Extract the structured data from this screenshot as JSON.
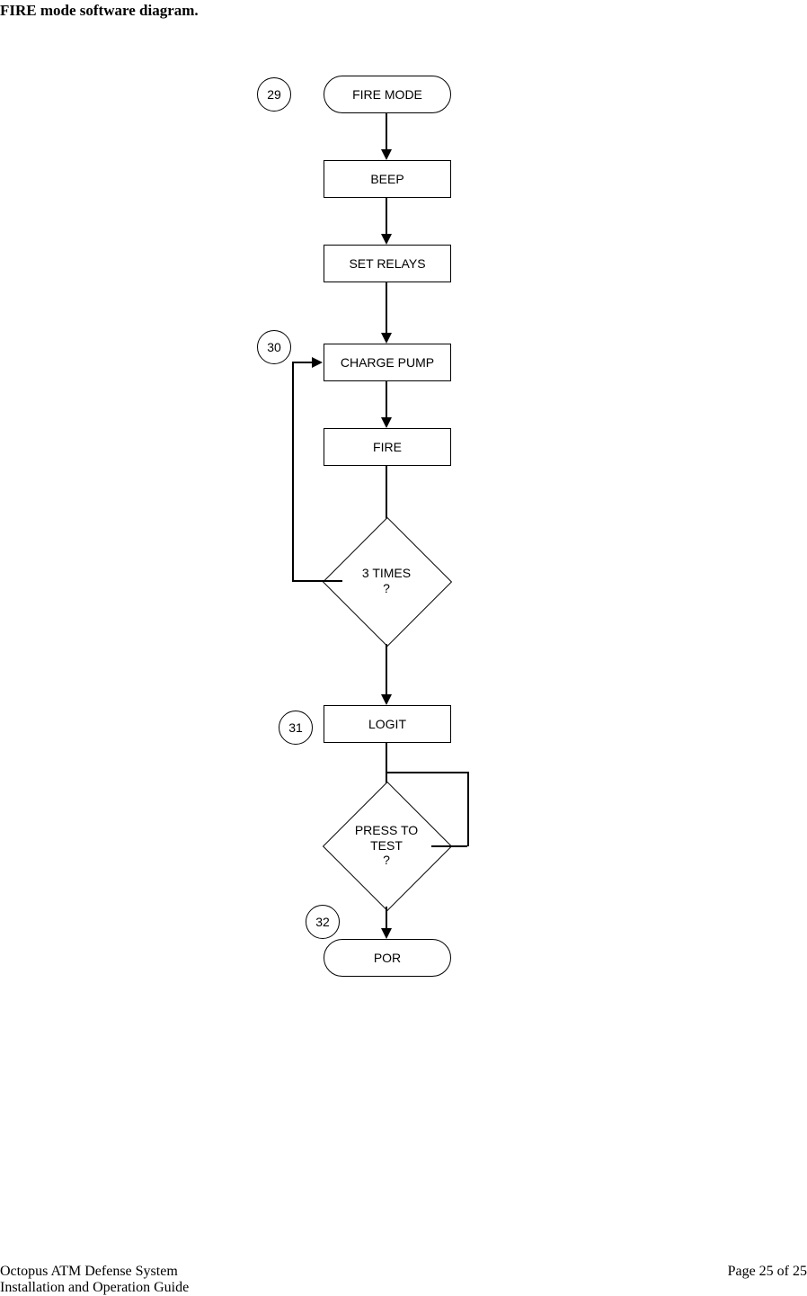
{
  "title": "FIRE mode software diagram.",
  "nodes": {
    "start": "FIRE MODE",
    "beep": "BEEP",
    "set_relays": "SET RELAYS",
    "charge_pump": "CHARGE PUMP",
    "fire": "FIRE",
    "three_times": "3 TIMES\n?",
    "logit": "LOGIT",
    "press_to_test": "PRESS TO\nTEST\n?",
    "por": "POR"
  },
  "refs": {
    "r29": "29",
    "r30": "30",
    "r31": "31",
    "r32": "32"
  },
  "footer": {
    "line1": "Octopus ATM Defense System",
    "line2": "Installation and Operation Guide",
    "page": "Page 25 of 25"
  }
}
